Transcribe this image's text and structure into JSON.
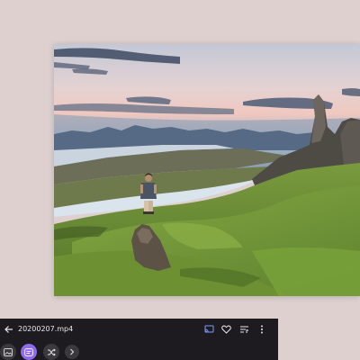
{
  "player": {
    "file_name": "20200207.mp4",
    "icons": {
      "back": "arrow-left-icon",
      "cast": "cast-icon",
      "favorite": "heart-icon",
      "playlist": "playlist-icon",
      "more": "more-vertical-icon",
      "gallery": "image-icon",
      "chapters": "chapter-list-icon",
      "shuffle": "shuffle-icon",
      "next": "chevron-right-icon"
    }
  },
  "colors": {
    "background": "#ddd0cf",
    "bar": "#1d1b1f",
    "accent": "#8f6bf0",
    "cast_active": "#7d9bff",
    "button": "#3b393e"
  }
}
